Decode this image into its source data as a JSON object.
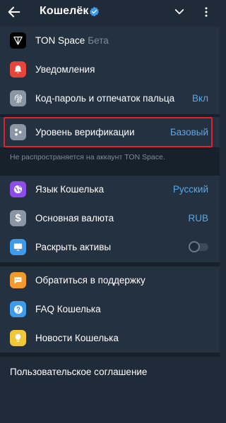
{
  "header": {
    "title": "Кошелёк"
  },
  "colors": {
    "background": "#1f2b38",
    "accent": "#5aa7e6",
    "highlight": "#e3212d"
  },
  "sections": {
    "s1": [
      {
        "label": "TON Space",
        "sub": "Бета",
        "icon": "ton-space-icon"
      },
      {
        "label": "Уведомления",
        "icon": "bell-icon"
      },
      {
        "label": "Код-пароль и отпечаток пальца",
        "value": "Вкл",
        "icon": "fingerprint-icon"
      }
    ],
    "s2": {
      "label": "Уровень верификации",
      "value": "Базовый",
      "icon": "verification-dots-icon",
      "note": "Не распространяется на аккаунт TON Space."
    },
    "s3": [
      {
        "label": "Язык Кошелька",
        "value": "Русский",
        "icon": "globe-icon"
      },
      {
        "label": "Основная валюта",
        "value": "RUB",
        "icon": "dollar-icon"
      },
      {
        "label": "Раскрыть активы",
        "icon": "monitor-icon",
        "toggle": false
      }
    ],
    "s4": [
      {
        "label": "Обратиться в поддержку",
        "icon": "chat-icon"
      },
      {
        "label": "FAQ Кошелька",
        "icon": "question-icon"
      },
      {
        "label": "Новости Кошелька",
        "icon": "lightbulb-icon"
      }
    ],
    "agreement": "Пользовательское соглашение"
  }
}
